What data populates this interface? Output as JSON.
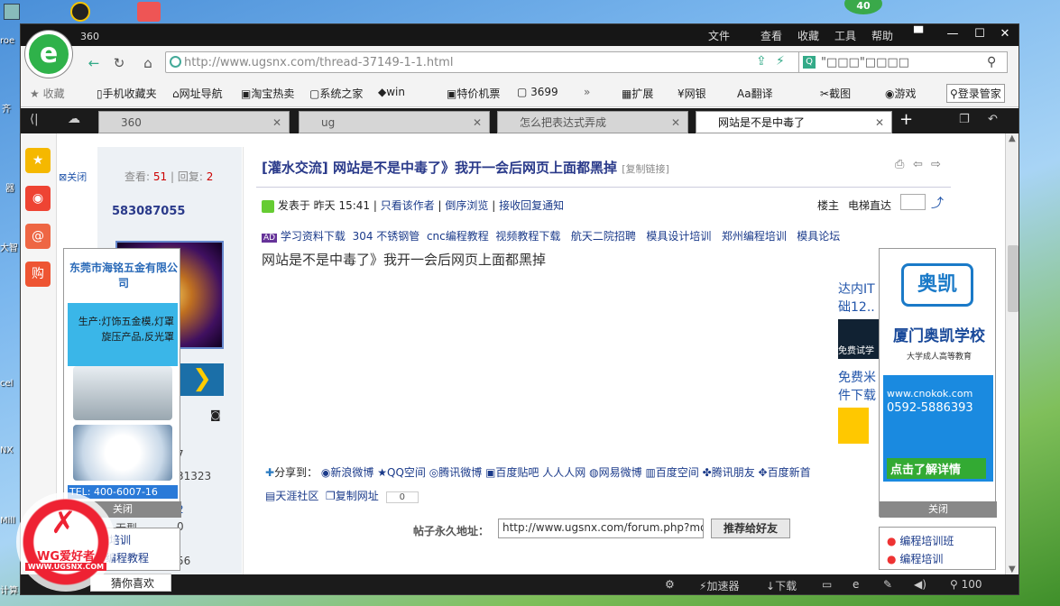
{
  "desktop": {
    "badge": "40",
    "left_labels": [
      "roe",
      "齐",
      "器",
      "大智",
      "cel",
      "NX",
      "Mill",
      "计算"
    ],
    "wg_logo": "WG爱好者",
    "wg_url": "WWW.UGSNX.COM"
  },
  "browser": {
    "version": "360",
    "menu": [
      "文件",
      "查看",
      "收藏",
      "工具",
      "帮助"
    ],
    "url": "http://www.ugsnx.com/thread-37149-1-1.html",
    "search_text": "\"□□□\"□□□□",
    "bookmarks": [
      "收藏",
      "手机收藏夹",
      "网址导航",
      "淘宝热卖",
      "系统之家",
      "win",
      "特价机票",
      "3699",
      "扩展",
      "网银",
      "翻译",
      "截图",
      "游戏",
      "登录管家"
    ],
    "tabs": [
      {
        "label": "360",
        "active": false
      },
      {
        "label": "ug",
        "active": false
      },
      {
        "label": "怎么把表达式弄成",
        "active": false
      },
      {
        "label": "网站是不是中毒了",
        "active": true
      }
    ],
    "status": {
      "accelerator": "加速器",
      "download": "下载",
      "zoom": "100"
    }
  },
  "page": {
    "close_label": "关闭",
    "stats": {
      "view_label": "查看:",
      "views": "51",
      "reply_label": "回复:",
      "replies": "2"
    },
    "author": "583087055",
    "sidebar_numbers": [
      "7",
      "31323",
      "2",
      "0",
      "56"
    ],
    "sidebar_word": "无型",
    "post": {
      "category": "[灌水交流]",
      "title": "网站是不是中毒了》我开一会后网页上面都黑掉",
      "copy_link": "[复制链接]",
      "posted": "发表于 昨天 15:41",
      "only_author": "只看该作者",
      "reverse": "倒序浏览",
      "notify": "接收回复通知",
      "floor": "楼主",
      "elevator": "电梯直达",
      "links": [
        "学习资料下载",
        "304 不锈钢管",
        "cnc编程教程",
        "视频教程下载",
        "航天二院招聘",
        "模具设计培训",
        "郑州编程培训",
        "模具论坛"
      ],
      "body": "网站是不是中毒了》我开一会后网页上面都黑掉",
      "share_label": "分享到：",
      "share": [
        "新浪微博",
        "QQ空间",
        "腾讯微博",
        "百度贴吧",
        "人人网",
        "网易微博",
        "百度空间",
        "腾讯朋友",
        "百度新首"
      ],
      "share2": [
        "天涯社区",
        "复制网址"
      ],
      "copy_count": "0",
      "permalink_label": "帖子永久地址：",
      "permalink": "http://www.ugsnx.com/forum.php?mod",
      "recommend": "推荐给好友"
    },
    "ad_left": {
      "company": "东莞市海铭五金有限公司",
      "product": "生产:灯饰五金模,灯罩 旋压产品,反光罩",
      "tel": "TEL: 400-6007-16",
      "close": "关闭"
    },
    "ad_mid": {
      "line1": "达内IT",
      "line2": "础12..",
      "line3": "免费试学",
      "line4": "免费米",
      "line5": "件下载"
    },
    "ad_right": {
      "brand": "奥凯",
      "school": "厦门奥凯学校",
      "sub": "大学成人高等教育",
      "site": "www.cnokok.com",
      "phone": "0592-5886393",
      "cta": "点击了解详情",
      "close": "关闭"
    },
    "bottom_right": [
      "编程培训班",
      "编程培训"
    ],
    "bottom_left": [
      "编程培训",
      "编程教程"
    ],
    "guess": "猜你喜欢"
  }
}
